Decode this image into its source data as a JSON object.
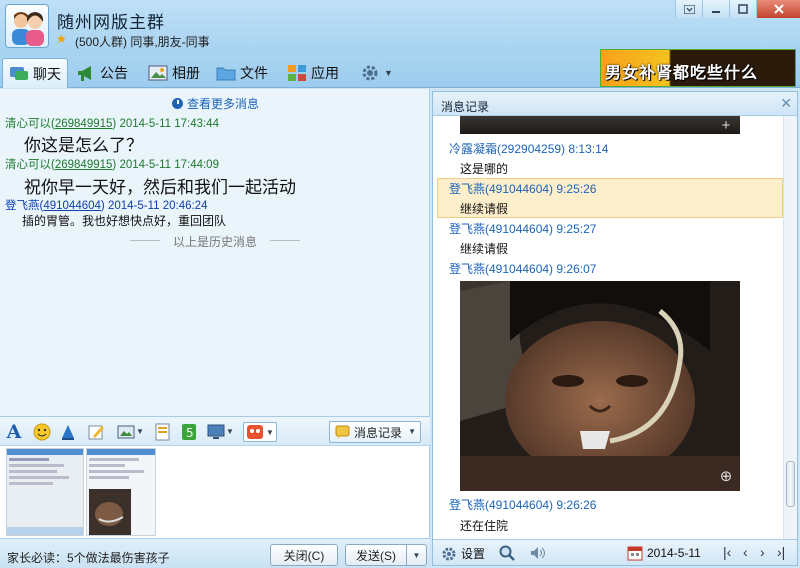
{
  "header": {
    "title": "随州网版主群",
    "subtitle": "(500人群) 同事,朋友-同事",
    "banner_text": "男女补肾都吃些什么"
  },
  "tabs": [
    {
      "label": "聊天",
      "icon": "chat-icon"
    },
    {
      "label": "公告",
      "icon": "announcement-icon"
    },
    {
      "label": "相册",
      "icon": "album-icon"
    },
    {
      "label": "文件",
      "icon": "folder-icon"
    },
    {
      "label": "应用",
      "icon": "apps-icon"
    }
  ],
  "chat": {
    "more_label": "查看更多消息",
    "messages": [
      {
        "sender": "清心可以",
        "qq": "269849915",
        "time": "2014-5-11 17:43:44",
        "text": "你这是怎么了？"
      },
      {
        "sender": "清心可以",
        "qq": "269849915",
        "time": "2014-5-11 17:44:09",
        "text": "祝你早一天好，然后和我们一起活动"
      },
      {
        "sender": "登飞燕",
        "qq": "491044604",
        "time": "2014-5-11 20:46:24",
        "text": "插的胃管。我也好想快点好，重回团队"
      }
    ],
    "history_label": "以上是历史消息"
  },
  "input_toolbar": {
    "msg_record_label": "消息记录"
  },
  "bottom": {
    "notice": "家长必读：5个做法最伤害孩子",
    "close_label": "关闭(C)",
    "send_label": "发送(S)"
  },
  "record": {
    "title": "消息记录",
    "entries": [
      {
        "name": "冷露凝霜(292904259) 8:13:14",
        "text": "这是哪的"
      },
      {
        "name": "登飞燕(491044604) 9:25:26",
        "text": "继续请假"
      },
      {
        "name": "登飞燕(491044604) 9:25:27",
        "text": "继续请假"
      },
      {
        "name": "登飞燕(491044604) 9:26:07",
        "text": ""
      },
      {
        "name": "登飞燕(491044604) 9:26:26",
        "text": "还在住院"
      }
    ],
    "footer": {
      "settings_label": "设置",
      "date": "2014-5-11"
    }
  },
  "colors": {
    "accent": "#1c64b8",
    "highlight": "#fdefcc",
    "titlebar": "#a6d2f0"
  }
}
